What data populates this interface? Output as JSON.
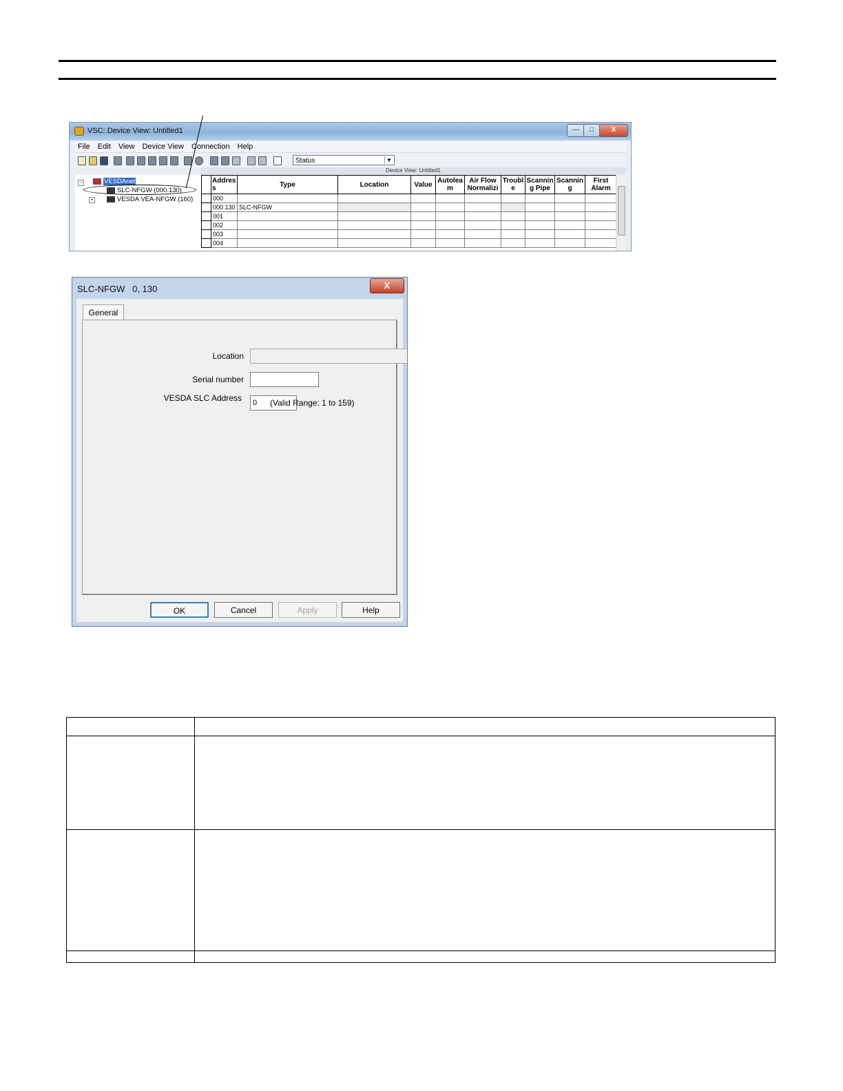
{
  "vsc_window": {
    "title": "VSC: Device View: Untitled1",
    "caption_buttons": {
      "minimize": "—",
      "maximize": "□",
      "close": "X"
    },
    "menu": [
      "File",
      "Edit",
      "View",
      "Device View",
      "Connection",
      "Help"
    ],
    "view_select": {
      "value": "Status"
    },
    "subwindow_title": "Device View: Untitled1",
    "tree": [
      {
        "label": "VESDAnet",
        "selected": true
      },
      {
        "label": "SLC-NFGW (000.130)"
      },
      {
        "label": "VESDA VEA-NFGW (160)"
      }
    ],
    "grid": {
      "columns": [
        "Addres\ns",
        "Type",
        "Location",
        "Value",
        "Autolea\nm",
        "Air Flow\nNormalizi",
        "Troubl\ne",
        "Scannin\ng Pipe",
        "Scannin\ng",
        "First\nAlarm"
      ],
      "rows": [
        [
          "000",
          "",
          "",
          "",
          "",
          "",
          "",
          "",
          "",
          ""
        ],
        [
          "000.130",
          "SLC-NFGW",
          "",
          "",
          "",
          "",
          "",
          "",
          "",
          ""
        ],
        [
          "001",
          "",
          "",
          "",
          "",
          "",
          "",
          "",
          "",
          ""
        ],
        [
          "002",
          "",
          "",
          "",
          "",
          "",
          "",
          "",
          "",
          ""
        ],
        [
          "003",
          "",
          "",
          "",
          "",
          "",
          "",
          "",
          "",
          ""
        ],
        [
          "004",
          "",
          "",
          "",
          "",
          "",
          "",
          "",
          "",
          ""
        ]
      ]
    }
  },
  "dialog": {
    "title": "SLC-NFGW   0, 130",
    "close_label": "X",
    "tab": "General",
    "fields": {
      "location_label": "Location",
      "location_value": "",
      "serial_label": "Serial number",
      "serial_value": "",
      "slc_label": "VESDA SLC Address",
      "slc_value": "0",
      "range_hint": "(Valid Range: 1 to 159)"
    },
    "buttons": {
      "ok": "OK",
      "cancel": "Cancel",
      "apply": "Apply",
      "help": "Help"
    }
  }
}
